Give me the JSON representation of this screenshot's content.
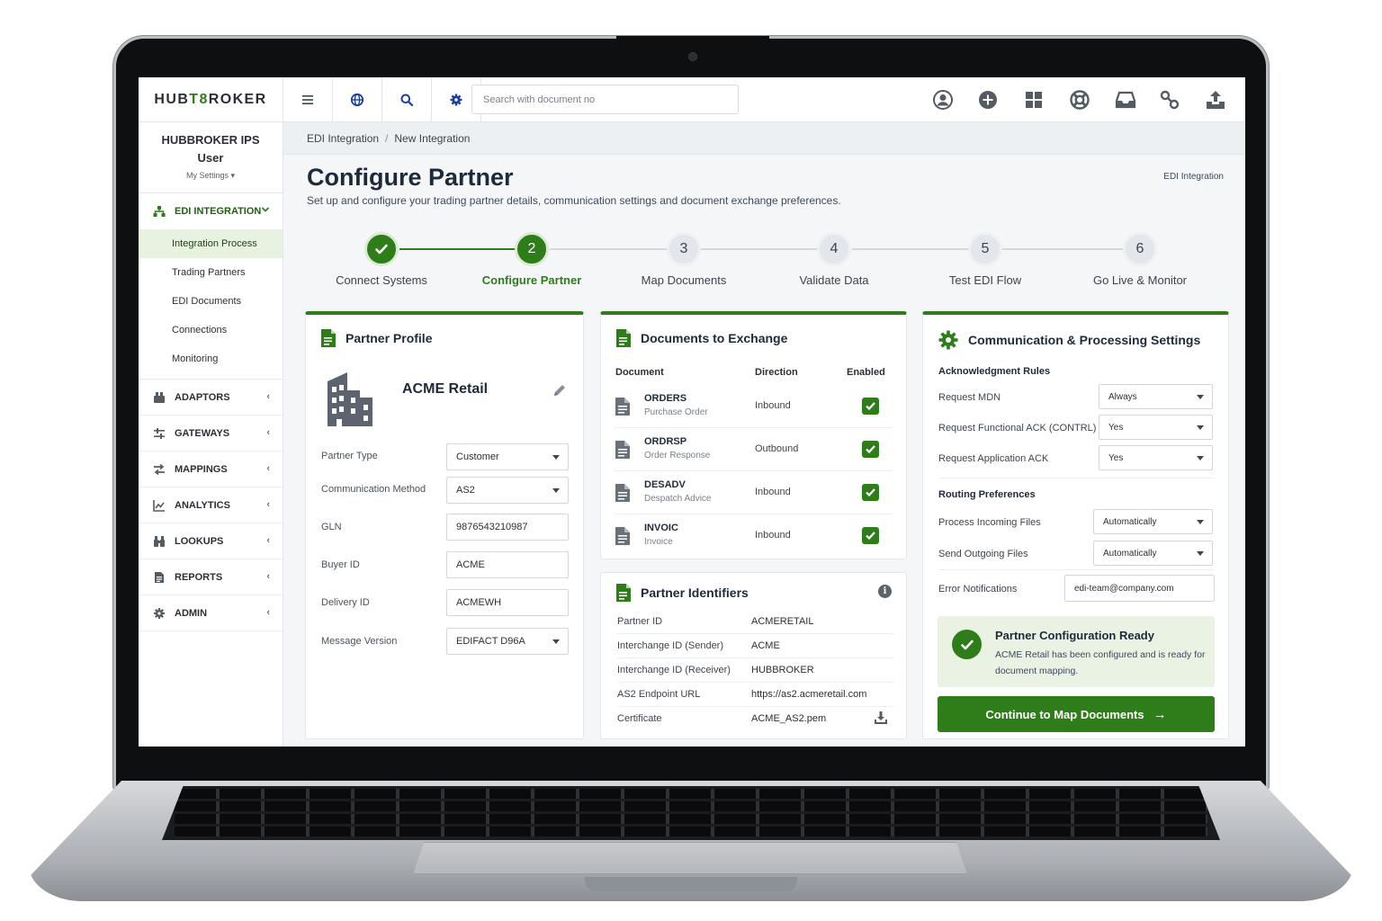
{
  "app": {
    "logo_part1": "HUB",
    "logo_accent": "T8",
    "logo_part2": "ROKER",
    "search_placeholder": "Search with document no"
  },
  "toolbar_icons": [
    "menu-icon",
    "globe-icon",
    "search-icon",
    "gear-icon",
    "user-circle-icon",
    "plus-circle-icon",
    "grid-icon",
    "lifebuoy-icon",
    "inbox-icon",
    "link-icon",
    "upload-icon"
  ],
  "user": {
    "name_line1": "HUBBROKER IPS",
    "name_line2": "User",
    "settings_label": "My Settings ▾"
  },
  "sidebar": {
    "active_section": "EDI INTEGRATION",
    "active_items": [
      "Integration Process",
      "Trading Partners",
      "EDI Documents",
      "Connections",
      "Monitoring"
    ],
    "sections": [
      "ADAPTORS",
      "GATEWAYS",
      "MAPPINGS",
      "ANALYTICS",
      "LOOKUPS",
      "REPORTS",
      "ADMIN"
    ]
  },
  "breadcrumb": {
    "root": "EDI Integration",
    "separator": "/",
    "current": "New Integration"
  },
  "page": {
    "title": "Configure Partner",
    "subtitle": "Set up and configure your trading partner details, communication settings and document exchange preferences.",
    "tag": "EDI Integration"
  },
  "stepper": {
    "steps": [
      {
        "number": "1",
        "label": "Connect Systems",
        "state": "done"
      },
      {
        "number": "2",
        "label": "Configure Partner",
        "state": "current"
      },
      {
        "number": "3",
        "label": "Map Documents",
        "state": "todo"
      },
      {
        "number": "4",
        "label": "Validate Data",
        "state": "todo"
      },
      {
        "number": "5",
        "label": "Test EDI Flow",
        "state": "todo"
      },
      {
        "number": "6",
        "label": "Go Live & Monitor",
        "state": "todo"
      }
    ]
  },
  "partner_profile": {
    "title": "Partner Profile",
    "partner_name": "ACME Retail",
    "fields": [
      {
        "label": "Partner Type",
        "value": "Customer",
        "type": "select"
      },
      {
        "label": "Communication Method",
        "value": "AS2",
        "type": "select"
      },
      {
        "label": "GLN",
        "value": "9876543210987",
        "type": "input"
      },
      {
        "label": "Buyer ID",
        "value": "ACME",
        "type": "input"
      },
      {
        "label": "Delivery ID",
        "value": "ACMEWH",
        "type": "input"
      },
      {
        "label": "Message Version",
        "value": "EDIFACT D96A",
        "type": "select"
      }
    ]
  },
  "documents": {
    "title": "Documents to Exchange",
    "headers": {
      "document": "Document",
      "direction": "Direction",
      "enabled": "Enabled"
    },
    "rows": [
      {
        "code": "ORDERS",
        "name": "Purchase Order",
        "direction": "Inbound",
        "enabled": true
      },
      {
        "code": "ORDRSP",
        "name": "Order Response",
        "direction": "Outbound",
        "enabled": true
      },
      {
        "code": "DESADV",
        "name": "Despatch Advice",
        "direction": "Inbound",
        "enabled": true
      },
      {
        "code": "INVOIC",
        "name": "Invoice",
        "direction": "Inbound",
        "enabled": true
      }
    ]
  },
  "identifiers": {
    "title": "Partner Identifiers",
    "rows": [
      {
        "label": "Partner ID",
        "value": "ACMERETAIL"
      },
      {
        "label": "Interchange ID (Sender)",
        "value": "ACME"
      },
      {
        "label": "Interchange ID (Receiver)",
        "value": "HUBBROKER"
      },
      {
        "label": "AS2 Endpoint URL",
        "value": "https://as2.acmeretail.com"
      },
      {
        "label": "Certificate",
        "value": "ACME_AS2.pem"
      }
    ]
  },
  "settings": {
    "title": "Communication & Processing Settings",
    "ack_title": "Acknowledgment Rules",
    "ack_rules": [
      {
        "label": "Request MDN",
        "value": "Always"
      },
      {
        "label": "Request Functional ACK (CONTRL)",
        "value": "Yes"
      },
      {
        "label": "Request Application ACK",
        "value": "Yes"
      }
    ],
    "routing_title": "Routing Preferences",
    "routing": [
      {
        "label": "Process Incoming Files",
        "value": "Automatically"
      },
      {
        "label": "Send Outgoing Files",
        "value": "Automatically"
      }
    ],
    "error_label": "Error Notifications",
    "error_value": "edi-team@company.com",
    "ready_title": "Partner Configuration Ready",
    "ready_text": "ACME Retail has been configured and is ready for document mapping.",
    "cta_label": "Continue to Map Documents",
    "cta_arrow": "→"
  },
  "colors": {
    "accent": "#2e7d1a",
    "nav_blue": "#1d3f9a",
    "ready_bg": "#eaf3e3"
  }
}
